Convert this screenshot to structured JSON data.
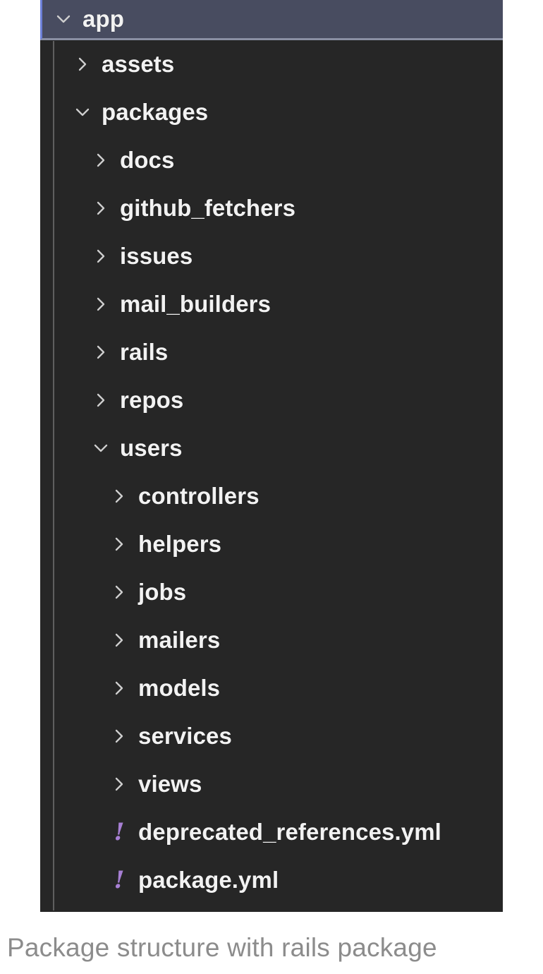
{
  "caption": "Package structure with rails package",
  "colors": {
    "panel_background": "#262626",
    "selected_row_background": "#484C60",
    "selected_row_accent": "#6c7fd8",
    "label_text": "#f2f2f2",
    "twisty": "#cfcfcf",
    "yaml_icon": "#a77fd4",
    "caption_text": "#8c8c8c",
    "indent_guide": "#6a6a6a"
  },
  "tree": {
    "rows": [
      {
        "label": "app",
        "level": 0,
        "icon": "chevron-down-icon",
        "kind": "folder",
        "expanded": true,
        "selected": true
      },
      {
        "label": "assets",
        "level": 1,
        "icon": "chevron-right-icon",
        "kind": "folder",
        "expanded": false,
        "selected": false
      },
      {
        "label": "packages",
        "level": 1,
        "icon": "chevron-down-icon",
        "kind": "folder",
        "expanded": true,
        "selected": false
      },
      {
        "label": "docs",
        "level": 2,
        "icon": "chevron-right-icon",
        "kind": "folder",
        "expanded": false,
        "selected": false
      },
      {
        "label": "github_fetchers",
        "level": 2,
        "icon": "chevron-right-icon",
        "kind": "folder",
        "expanded": false,
        "selected": false
      },
      {
        "label": "issues",
        "level": 2,
        "icon": "chevron-right-icon",
        "kind": "folder",
        "expanded": false,
        "selected": false
      },
      {
        "label": "mail_builders",
        "level": 2,
        "icon": "chevron-right-icon",
        "kind": "folder",
        "expanded": false,
        "selected": false
      },
      {
        "label": "rails",
        "level": 2,
        "icon": "chevron-right-icon",
        "kind": "folder",
        "expanded": false,
        "selected": false
      },
      {
        "label": "repos",
        "level": 2,
        "icon": "chevron-right-icon",
        "kind": "folder",
        "expanded": false,
        "selected": false
      },
      {
        "label": "users",
        "level": 2,
        "icon": "chevron-down-icon",
        "kind": "folder",
        "expanded": true,
        "selected": false
      },
      {
        "label": "controllers",
        "level": 3,
        "icon": "chevron-right-icon",
        "kind": "folder",
        "expanded": false,
        "selected": false
      },
      {
        "label": "helpers",
        "level": 3,
        "icon": "chevron-right-icon",
        "kind": "folder",
        "expanded": false,
        "selected": false
      },
      {
        "label": "jobs",
        "level": 3,
        "icon": "chevron-right-icon",
        "kind": "folder",
        "expanded": false,
        "selected": false
      },
      {
        "label": "mailers",
        "level": 3,
        "icon": "chevron-right-icon",
        "kind": "folder",
        "expanded": false,
        "selected": false
      },
      {
        "label": "models",
        "level": 3,
        "icon": "chevron-right-icon",
        "kind": "folder",
        "expanded": false,
        "selected": false
      },
      {
        "label": "services",
        "level": 3,
        "icon": "chevron-right-icon",
        "kind": "folder",
        "expanded": false,
        "selected": false
      },
      {
        "label": "views",
        "level": 3,
        "icon": "chevron-right-icon",
        "kind": "folder",
        "expanded": false,
        "selected": false
      },
      {
        "label": "deprecated_references.yml",
        "level": 3,
        "icon": "yaml-file-icon",
        "kind": "file",
        "glyph": "!",
        "selected": false
      },
      {
        "label": "package.yml",
        "level": 3,
        "icon": "yaml-file-icon",
        "kind": "file",
        "glyph": "!",
        "selected": false
      }
    ]
  }
}
